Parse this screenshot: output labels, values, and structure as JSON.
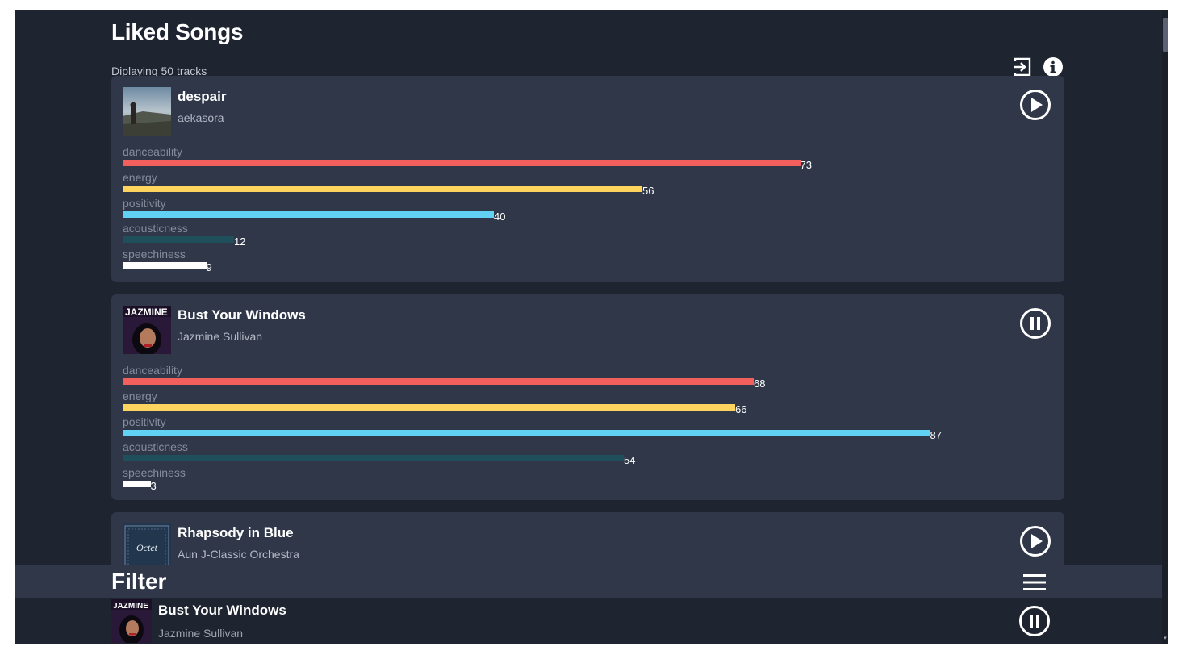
{
  "page": {
    "title": "Liked Songs",
    "subtitle": "Diplaying 50 tracks",
    "icons": [
      "logout-icon",
      "info-icon"
    ]
  },
  "colors": {
    "background": "#1f2530",
    "card": "#2f3749",
    "danceability": "#f25f5c",
    "energy": "#ffd45e",
    "positivity": "#62d2f4",
    "acousticness": "#1f4f5a",
    "speechiness": "#ffffff"
  },
  "metric_labels": {
    "danceability": "danceability",
    "energy": "energy",
    "positivity": "positivity",
    "acousticness": "acousticness",
    "speechiness": "speechiness"
  },
  "tracks": [
    {
      "name": "despair",
      "artist": "aekasora",
      "state": "play-icon",
      "metrics": {
        "danceability": 73,
        "energy": 56,
        "positivity": 40,
        "acousticness": 12,
        "speechiness": 9
      },
      "metric_text": {
        "danceability": "73",
        "energy": "56",
        "positivity": "40",
        "acousticness": "12",
        "speechiness": "9"
      }
    },
    {
      "name": "Bust Your Windows",
      "artist": "Jazmine Sullivan",
      "state": "pause-icon",
      "cover_text": "JAZMINE",
      "metrics": {
        "danceability": 68,
        "energy": 66,
        "positivity": 87,
        "acousticness": 54,
        "speechiness": 3
      },
      "metric_text": {
        "danceability": "68",
        "energy": "66",
        "positivity": "87",
        "acousticness": "54",
        "speechiness": "3"
      }
    },
    {
      "name": "Rhapsody in Blue",
      "artist": "Aun J-Classic Orchestra",
      "state": "play-icon",
      "cover_text": "Octet"
    }
  ],
  "filter": {
    "title": "Filter",
    "icon": "menu-icon"
  },
  "now_playing": {
    "name": "Bust Your Windows",
    "artist": "Jazmine Sullivan",
    "cover_text": "JAZMINE",
    "state": "pause-icon"
  }
}
